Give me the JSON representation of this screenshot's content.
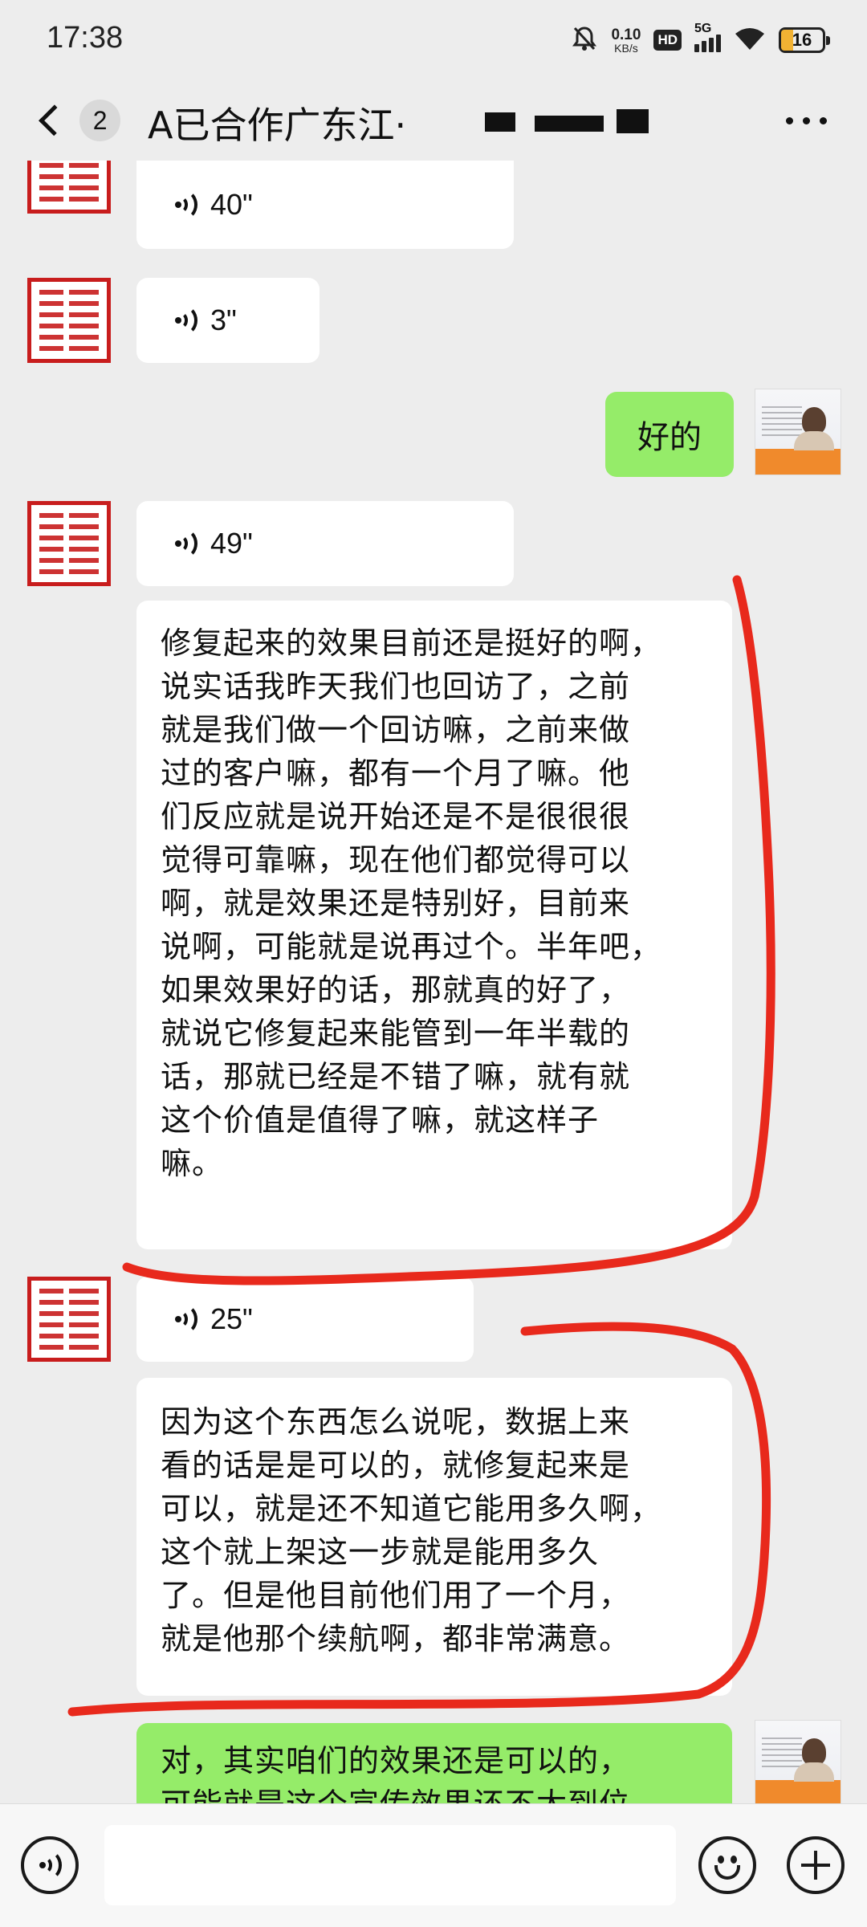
{
  "status_bar": {
    "time": "17:38",
    "net_speed_value": "0.10",
    "net_speed_unit": "KB/s",
    "hd": "HD",
    "network": "5G",
    "battery": "16",
    "icons": [
      "mute-bell-icon",
      "signal-icon",
      "wifi-icon",
      "battery-icon"
    ]
  },
  "header": {
    "unread_count": "2",
    "title": "A已合作广东江·"
  },
  "messages": [
    {
      "side": "left",
      "type": "voice",
      "duration": "40\""
    },
    {
      "side": "left",
      "type": "voice",
      "duration": "3\""
    },
    {
      "side": "right",
      "type": "text",
      "text": "好的"
    },
    {
      "side": "left",
      "type": "voice",
      "duration": "49\""
    },
    {
      "side": "left",
      "type": "text",
      "lines": [
        "修复起来的效果目前还是挺好的啊，",
        "说实话我昨天我们也回访了，之前",
        "就是我们做一个回访嘛，之前来做",
        "过的客户嘛，都有一个月了嘛。他",
        "们反应就是说开始还是不是很很很",
        "觉得可靠嘛，现在他们都觉得可以",
        "啊，就是效果还是特别好，目前来",
        "说啊，可能就是说再过个。半年吧，",
        "如果效果好的话，那就真的好了，",
        "就说它修复起来能管到一年半载的",
        "话，那就已经是不错了嘛，就有就",
        "这个价值是值得了嘛，就这样子",
        "嘛。"
      ]
    },
    {
      "side": "left",
      "type": "voice",
      "duration": "25\""
    },
    {
      "side": "left",
      "type": "text",
      "lines": [
        "因为这个东西怎么说呢，数据上来",
        "看的话是是可以的，就修复起来是",
        "可以，就是还不知道它能用多久啊，",
        "这个就上架这一步就是能用多久",
        "了。但是他目前他们用了一个月，",
        "就是他那个续航啊，都非常满意。"
      ]
    },
    {
      "side": "right",
      "type": "text",
      "lines": [
        "对，其实咱们的效果还是可以的，",
        "可能就是这个宣传效果还不太到位"
      ]
    }
  ],
  "input_bar": {
    "voice_toggle_icon": "voice-mode-icon",
    "emoji_icon": "emoji-icon",
    "plus_icon": "plus-icon",
    "input_value": ""
  },
  "colors": {
    "background": "#ededed",
    "incoming_bubble": "#ffffff",
    "outgoing_bubble": "#95ec69",
    "annotation": "#e8291c",
    "seal": "#c81d1d"
  }
}
